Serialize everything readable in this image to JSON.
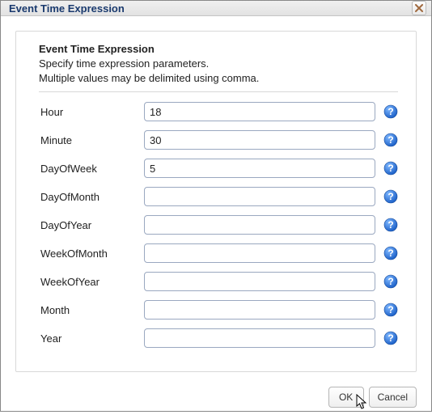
{
  "dialog": {
    "title": "Event Time Expression",
    "close_icon": "close"
  },
  "section": {
    "heading": "Event Time Expression",
    "line1": "Specify time expression parameters.",
    "line2": "Multiple values may be delimited using comma."
  },
  "fields": [
    {
      "key": "hour",
      "label": "Hour",
      "value": "18"
    },
    {
      "key": "minute",
      "label": "Minute",
      "value": "30"
    },
    {
      "key": "dayofweek",
      "label": "DayOfWeek",
      "value": "5"
    },
    {
      "key": "dayofmonth",
      "label": "DayOfMonth",
      "value": ""
    },
    {
      "key": "dayofyear",
      "label": "DayOfYear",
      "value": ""
    },
    {
      "key": "weekofmonth",
      "label": "WeekOfMonth",
      "value": ""
    },
    {
      "key": "weekofyear",
      "label": "WeekOfYear",
      "value": ""
    },
    {
      "key": "month",
      "label": "Month",
      "value": ""
    },
    {
      "key": "year",
      "label": "Year",
      "value": ""
    }
  ],
  "buttons": {
    "ok": "OK",
    "cancel": "Cancel"
  }
}
